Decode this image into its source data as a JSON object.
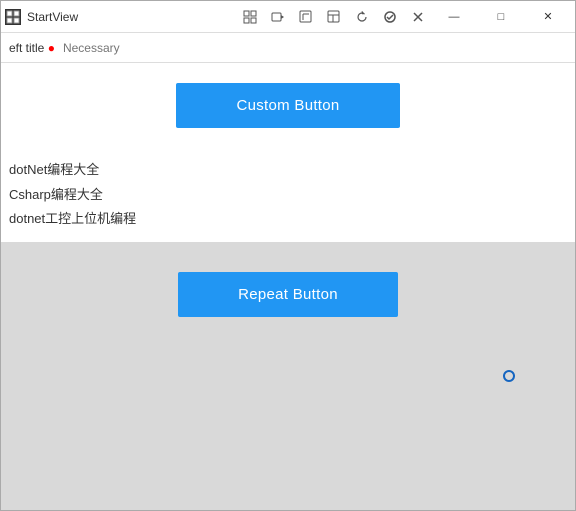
{
  "window": {
    "title": "StartView",
    "app_icon": "▣"
  },
  "toolbar": {
    "buttons": [
      {
        "name": "grid-icon",
        "symbol": "⊞"
      },
      {
        "name": "video-icon",
        "symbol": "▷"
      },
      {
        "name": "cursor-icon",
        "symbol": "↖"
      },
      {
        "name": "layout-icon",
        "symbol": "⊡"
      },
      {
        "name": "refresh-icon",
        "symbol": "↻"
      },
      {
        "name": "check-icon",
        "symbol": "✓"
      },
      {
        "name": "close-small-icon",
        "symbol": "✕"
      }
    ]
  },
  "window_controls": {
    "minimize": "—",
    "maximize": "□",
    "close": "✕"
  },
  "address_bar": {
    "left_title": "eft title",
    "required_dot": "●",
    "placeholder": "Necessary"
  },
  "content": {
    "custom_button_label": "Custom Button",
    "text_items": [
      "dotNet编程大全",
      "Csharp编程大全",
      "dotnet工控上位机编程"
    ],
    "repeat_button_label": "Repeat Button"
  }
}
